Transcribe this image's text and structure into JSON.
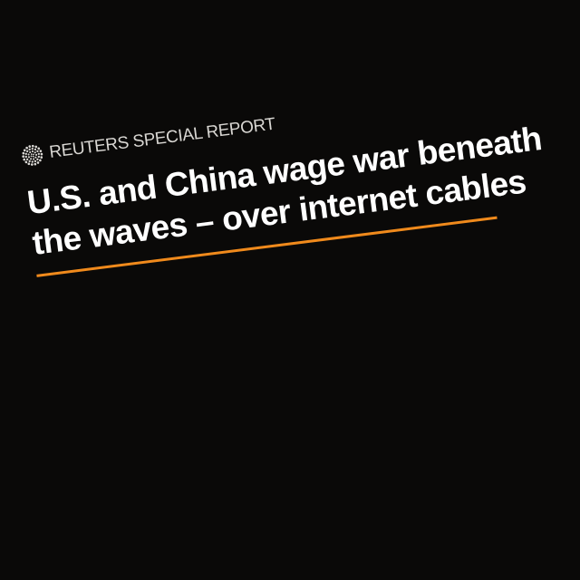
{
  "header": {
    "brand_label": "REUTERS SPECIAL REPORT"
  },
  "headline": {
    "line1": "U.S. and China wage war beneath",
    "line2": "the waves – over internet cables"
  },
  "colors": {
    "background": "#0a0908",
    "headline_text": "#ffffff",
    "brand_text": "#d9d7d3",
    "accent_rule": "#f08a1c"
  },
  "icons": {
    "logo": "reuters-dot-ring-logo"
  }
}
